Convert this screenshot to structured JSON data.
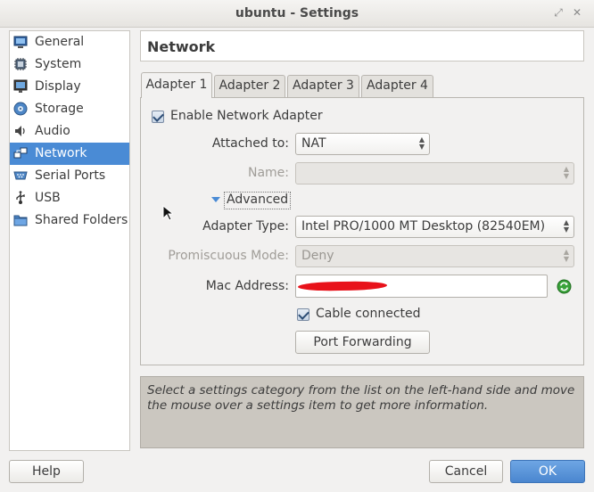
{
  "window": {
    "title": "ubuntu - Settings"
  },
  "sidebar": {
    "items": [
      {
        "label": "General",
        "icon": "general-icon"
      },
      {
        "label": "System",
        "icon": "system-icon"
      },
      {
        "label": "Display",
        "icon": "display-icon"
      },
      {
        "label": "Storage",
        "icon": "storage-icon"
      },
      {
        "label": "Audio",
        "icon": "audio-icon"
      },
      {
        "label": "Network",
        "icon": "network-icon",
        "selected": true
      },
      {
        "label": "Serial Ports",
        "icon": "serial-ports-icon"
      },
      {
        "label": "USB",
        "icon": "usb-icon"
      },
      {
        "label": "Shared Folders",
        "icon": "shared-folders-icon"
      }
    ]
  },
  "header": {
    "title": "Network"
  },
  "tabs": [
    {
      "label": "Adapter 1",
      "active": true
    },
    {
      "label": "Adapter 2"
    },
    {
      "label": "Adapter 3"
    },
    {
      "label": "Adapter 4"
    }
  ],
  "adapter": {
    "enable_label": "Enable Network Adapter",
    "attached_label": "Attached to:",
    "attached_value": "NAT",
    "name_label": "Name:",
    "name_value": "",
    "advanced_label": "Advanced",
    "adapter_type_label": "Adapter Type:",
    "adapter_type_value": "Intel PRO/1000 MT Desktop (82540EM)",
    "promiscuous_label": "Promiscuous Mode:",
    "promiscuous_value": "Deny",
    "mac_label": "Mac Address:",
    "cable_label": "Cable connected",
    "port_forwarding_label": "Port Forwarding"
  },
  "info": {
    "text": "Select a settings category from the list on the left-hand side and move the mouse over a settings item to get more information."
  },
  "buttons": {
    "help": "Help",
    "cancel": "Cancel",
    "ok": "OK"
  },
  "colors": {
    "selection": "#4a8bd5",
    "ok_button": "#4a86cf",
    "redaction": "#e8121a"
  }
}
